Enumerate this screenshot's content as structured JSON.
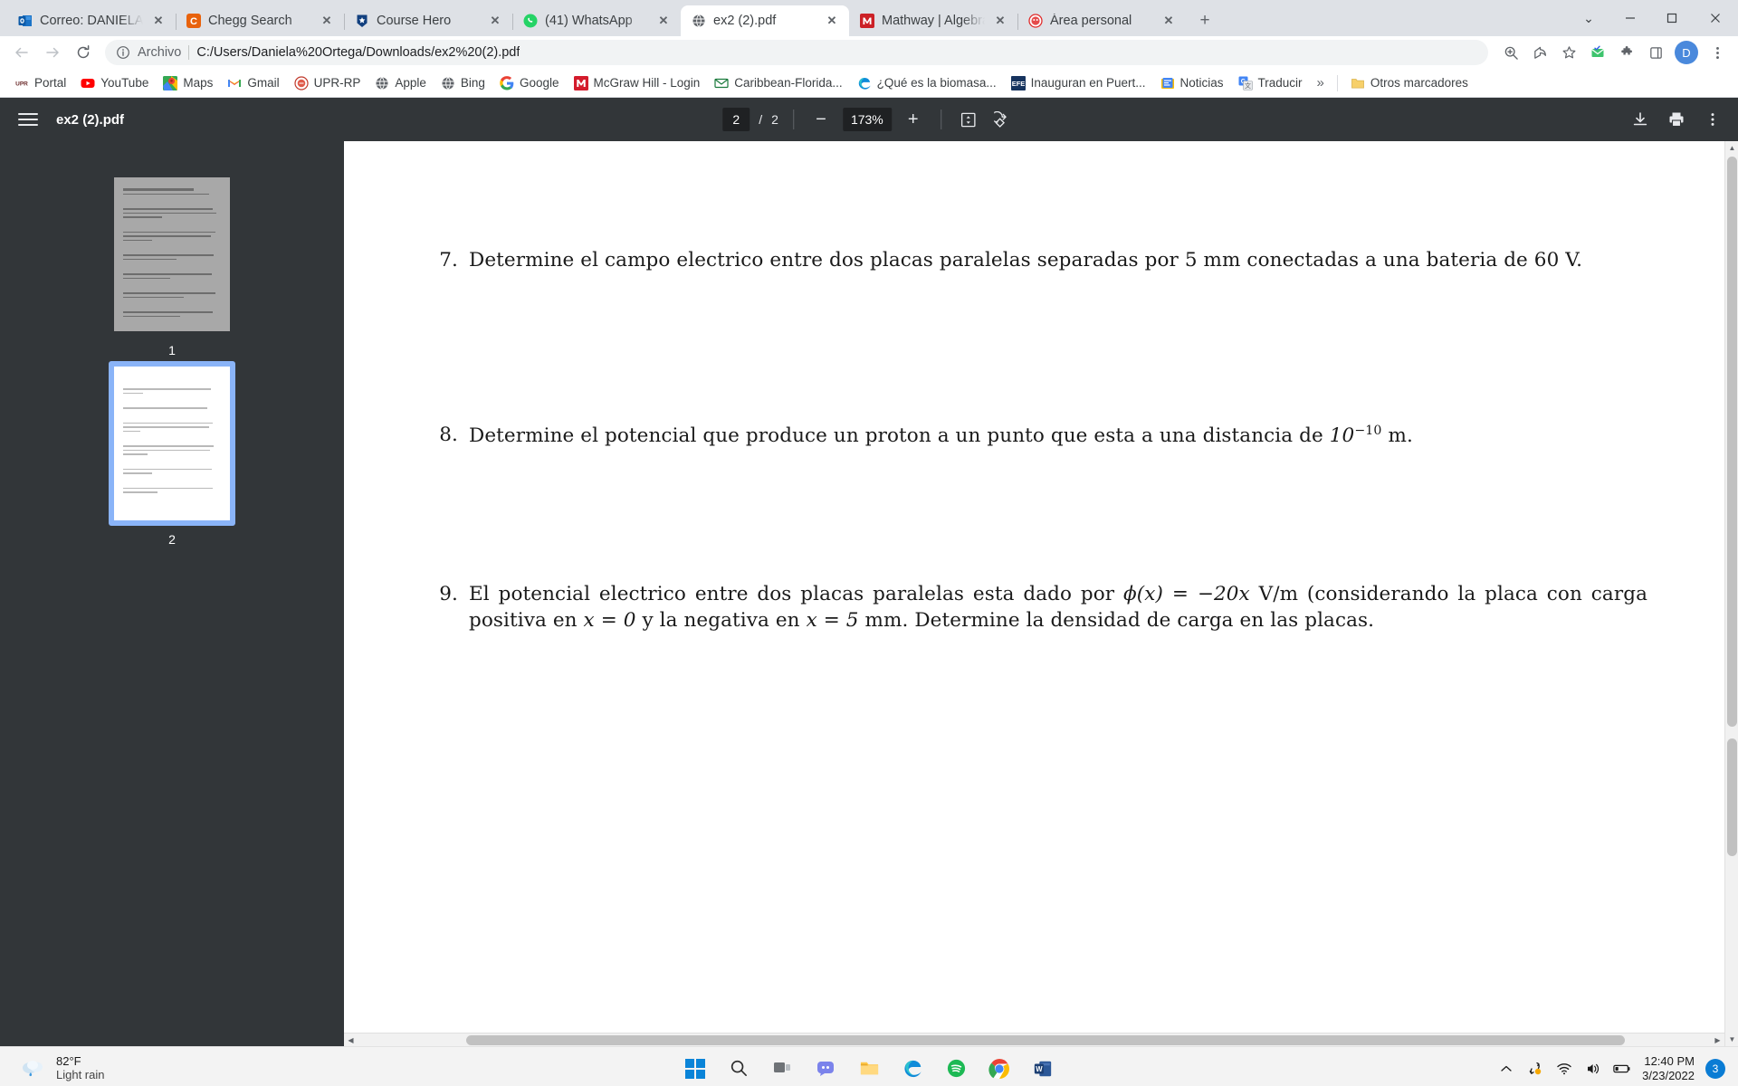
{
  "browser": {
    "tabs": [
      {
        "title": "Correo: DANIELA S OR",
        "icon": "outlook-icon",
        "active": false
      },
      {
        "title": "Chegg Search",
        "icon": "chegg-icon",
        "active": false
      },
      {
        "title": "Course Hero",
        "icon": "coursehero-icon",
        "active": false
      },
      {
        "title": "(41) WhatsApp",
        "icon": "whatsapp-icon",
        "active": false
      },
      {
        "title": "ex2 (2).pdf",
        "icon": "globe-icon",
        "active": true
      },
      {
        "title": "Mathway | Algebra Pr",
        "icon": "mathway-icon",
        "active": false
      },
      {
        "title": "Área personal",
        "icon": "moodle-icon",
        "active": false
      }
    ],
    "new_tab_label": "+",
    "window_controls": {
      "minimize": "—",
      "maximize": "❐",
      "close": "✕",
      "tab_search": "⌄"
    },
    "omnibox": {
      "scheme_label": "Archivo",
      "url": "C:/Users/Daniela%20Ortega/Downloads/ex2%20(2).pdf"
    },
    "profile_initial": "D",
    "bookmarks": [
      {
        "label": "Portal",
        "icon": "upr-icon"
      },
      {
        "label": "YouTube",
        "icon": "youtube-icon"
      },
      {
        "label": "Maps",
        "icon": "google-maps-icon"
      },
      {
        "label": "Gmail",
        "icon": "gmail-icon"
      },
      {
        "label": "UPR-RP",
        "icon": "upr-rp-icon"
      },
      {
        "label": "Apple",
        "icon": "globe-icon"
      },
      {
        "label": "Bing",
        "icon": "globe-icon"
      },
      {
        "label": "Google",
        "icon": "google-icon"
      },
      {
        "label": "McGraw Hill - Login",
        "icon": "mcgrawhill-icon"
      },
      {
        "label": "Caribbean-Florida...",
        "icon": "envelope-icon"
      },
      {
        "label": "¿Qué es la biomasa...",
        "icon": "edge-icon"
      },
      {
        "label": "Inauguran en Puert...",
        "icon": "efe-icon"
      },
      {
        "label": "Noticias",
        "icon": "google-news-icon"
      },
      {
        "label": "Traducir",
        "icon": "google-translate-icon"
      }
    ],
    "bookmarks_overflow": "»",
    "other_bookmarks": {
      "label": "Otros marcadores",
      "icon": "folder-icon"
    }
  },
  "pdf_viewer": {
    "filename": "ex2 (2).pdf",
    "sidebar_toggle": "sidebar-toggle-icon",
    "current_page": "2",
    "page_separator": "/",
    "total_pages": "2",
    "zoom_out_label": "−",
    "zoom_level": "173%",
    "zoom_in_label": "+",
    "fit_page_label": "fit-page-icon",
    "rotate_label": "rotate-icon",
    "download_label": "download-icon",
    "print_label": "print-icon",
    "more_label": "more-vertical-icon",
    "thumbnails": [
      {
        "label": "1",
        "selected": false
      },
      {
        "label": "2",
        "selected": true
      }
    ]
  },
  "document": {
    "problems": [
      {
        "number": "7.",
        "segments": [
          {
            "t": "text",
            "v": "Determine el campo electrico entre dos placas paralelas separadas por 5 mm conectadas a una bateria de 60 V."
          }
        ]
      },
      {
        "number": "8.",
        "segments": [
          {
            "t": "text",
            "v": "Determine el potencial que produce un proton a un punto que esta a una distancia de "
          },
          {
            "t": "math",
            "v": "10"
          },
          {
            "t": "sup",
            "v": "−10"
          },
          {
            "t": "text",
            "v": " m."
          }
        ]
      },
      {
        "number": "9.",
        "segments": [
          {
            "t": "text",
            "v": "El potencial electrico entre dos placas paralelas esta dado por "
          },
          {
            "t": "math",
            "v": "ϕ(x) = −20x"
          },
          {
            "t": "text",
            "v": " V/m (considerando la placa con carga positiva en "
          },
          {
            "t": "math",
            "v": "x = 0"
          },
          {
            "t": "text",
            "v": " y la negativa en "
          },
          {
            "t": "math",
            "v": "x = 5"
          },
          {
            "t": "text",
            "v": " mm. Determine la densidad de carga en las placas."
          }
        ]
      }
    ]
  },
  "taskbar": {
    "weather": {
      "temperature": "82°F",
      "condition": "Light rain",
      "icon": "rain-cloud-icon"
    },
    "apps": [
      {
        "name": "start-button",
        "icon": "windows-logo-icon"
      },
      {
        "name": "search-button",
        "icon": "search-icon"
      },
      {
        "name": "task-view-button",
        "icon": "task-view-icon"
      },
      {
        "name": "teams-chat-button",
        "icon": "chat-icon"
      },
      {
        "name": "file-explorer-button",
        "icon": "folder-icon"
      },
      {
        "name": "edge-button",
        "icon": "edge-icon"
      },
      {
        "name": "spotify-button",
        "icon": "spotify-icon"
      },
      {
        "name": "chrome-button",
        "icon": "chrome-icon"
      },
      {
        "name": "word-button",
        "icon": "word-icon"
      }
    ],
    "tray": {
      "show_hidden": "chevron-up-icon",
      "onedrive": "onedrive-sync-icon",
      "network": "wifi-icon",
      "volume": "speaker-icon",
      "battery": "battery-icon",
      "time": "12:40 PM",
      "date": "3/23/2022",
      "notification_count": "3"
    }
  }
}
